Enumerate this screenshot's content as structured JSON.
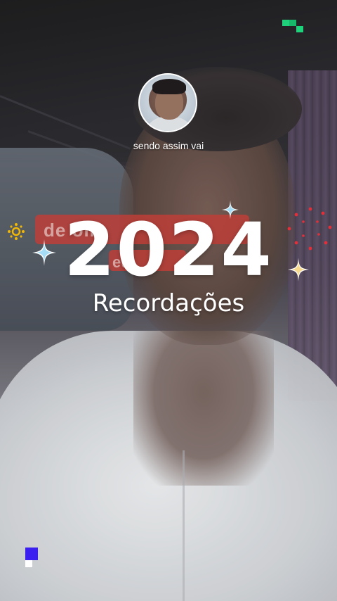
{
  "story": {
    "username": "sendo assim vai",
    "year": "2024",
    "subtitle": "Recordações"
  },
  "background_sign": {
    "line1": "de         om",
    "line2": "eu"
  },
  "colors": {
    "accent_green": "#1fd17a",
    "accent_blue": "#3b1ff0",
    "spark_gold": "#f2b705",
    "dots_red": "#e0303a"
  }
}
